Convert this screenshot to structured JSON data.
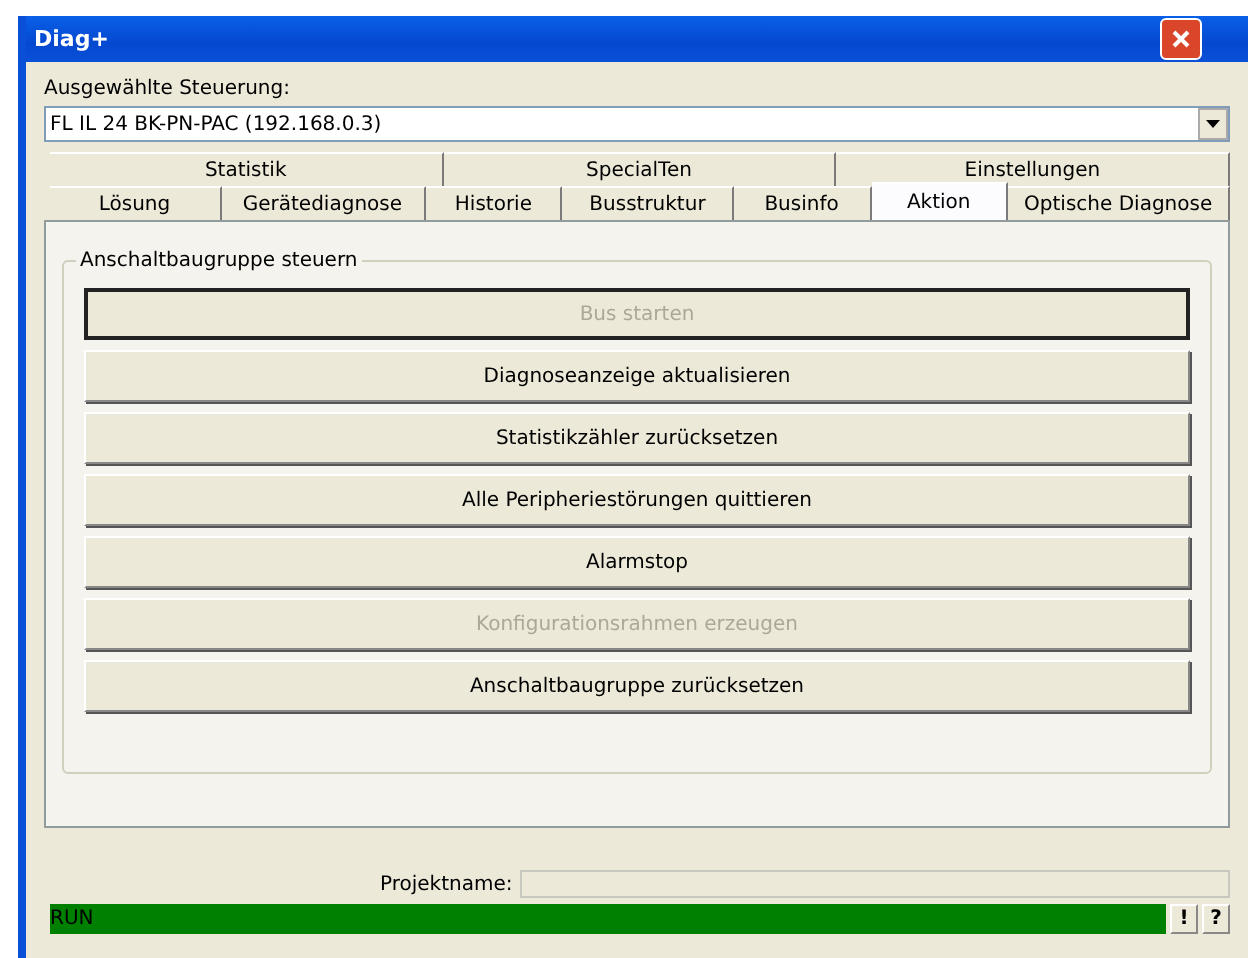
{
  "window": {
    "title": "Diag+"
  },
  "controller": {
    "label": "Ausgewählte Steuerung:",
    "value": "FL IL 24 BK-PN-PAC (192.168.0.3)"
  },
  "tab_rows": [
    [
      {
        "label": "Statistik",
        "selected": false
      },
      {
        "label": "SpecialTen",
        "selected": false
      },
      {
        "label": "Einstellungen",
        "selected": false
      }
    ],
    [
      {
        "label": "Lösung",
        "selected": false
      },
      {
        "label": "Gerätediagnose",
        "selected": false
      },
      {
        "label": "Historie",
        "selected": false
      },
      {
        "label": "Busstruktur",
        "selected": false
      },
      {
        "label": "Businfo",
        "selected": false
      },
      {
        "label": "Aktion",
        "selected": true
      },
      {
        "label": "Optische Diagnose",
        "selected": false
      }
    ]
  ],
  "group": {
    "title": "Anschaltbaugruppe steuern",
    "buttons": [
      {
        "label": "Bus starten",
        "disabled": true,
        "default": true
      },
      {
        "label": "Diagnoseanzeige aktualisieren",
        "disabled": false,
        "default": false
      },
      {
        "label": "Statistikzähler zurücksetzen",
        "disabled": false,
        "default": false
      },
      {
        "label": "Alle Peripheriestörungen quittieren",
        "disabled": false,
        "default": false
      },
      {
        "label": "Alarmstop",
        "disabled": false,
        "default": false
      },
      {
        "label": "Konfigurationsrahmen erzeugen",
        "disabled": true,
        "default": false
      },
      {
        "label": "Anschaltbaugruppe zurücksetzen",
        "disabled": false,
        "default": false
      }
    ]
  },
  "project": {
    "label": "Projektname:"
  },
  "status_bar": {
    "text": "RUN",
    "buttons": [
      "!",
      "?"
    ]
  }
}
